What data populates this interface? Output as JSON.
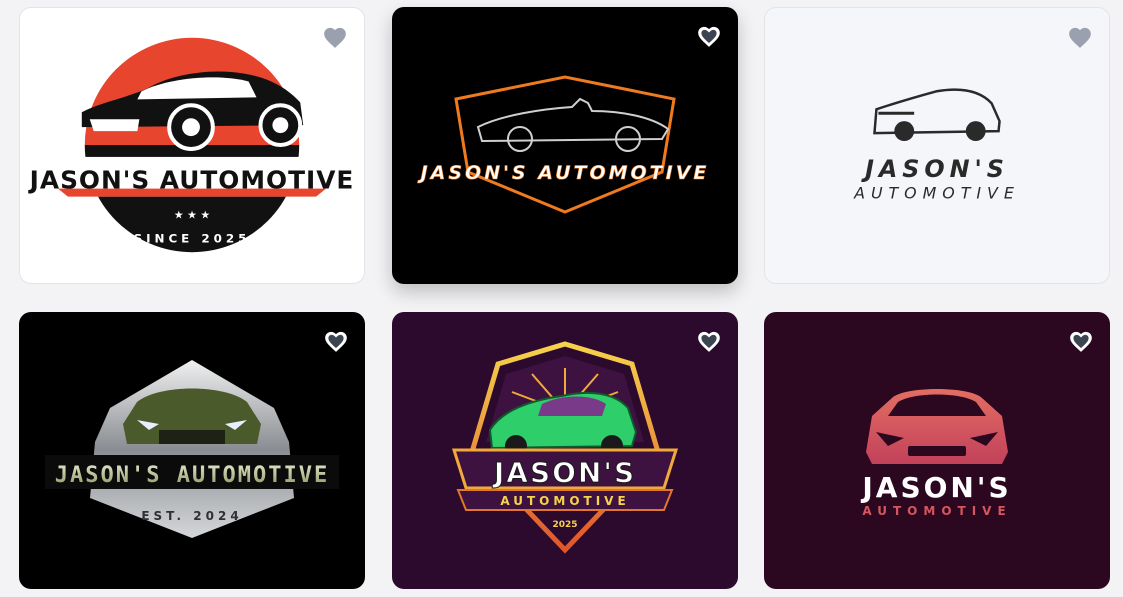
{
  "cards": [
    {
      "background": "#ffffff",
      "heart_color": "#9aa0ad",
      "brand_line1": "JASON'S AUTOMOTIVE",
      "tagline": "SINCE 2025",
      "stars": "★ ★ ★",
      "accent": "#e8452e"
    },
    {
      "background": "#000000",
      "heart_color": "#ffffff",
      "brand_line1": "JASON'S AUTOMOTIVE",
      "accent": "#f07a1e"
    },
    {
      "background": "#f5f6fa",
      "heart_color": "#9aa0ad",
      "brand_line1": "JASON'S",
      "brand_line2": "AUTOMOTIVE",
      "accent": "#2a2a2a"
    },
    {
      "background": "#000000",
      "heart_color": "#ffffff",
      "brand_line1": "JASON'S AUTOMOTIVE",
      "tagline": "EST. 2024",
      "accent": "#b7bca0"
    },
    {
      "background": "#2b0a2e",
      "heart_color": "#ffffff",
      "brand_line1": "JASON'S",
      "brand_line2": "AUTOMOTIVE",
      "tagline": "2025",
      "accent": "#e0772a"
    },
    {
      "background": "#2c0720",
      "heart_color": "#ffffff",
      "brand_line1": "JASON'S",
      "brand_line2": "AUTOMOTIVE",
      "accent": "#d5565d"
    }
  ]
}
